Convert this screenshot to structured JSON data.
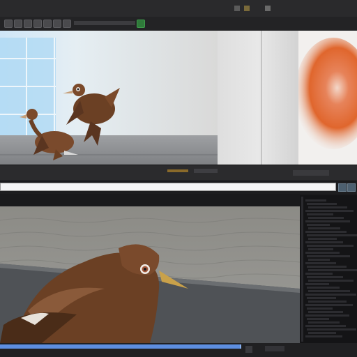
{
  "window": {
    "title": "",
    "menu_left": "",
    "menu_right": ""
  },
  "icons": {
    "toolbar": [
      "arrow-icon",
      "move-icon",
      "rotate-icon",
      "scale-icon",
      "camera-icon",
      "light-icon",
      "grid-icon",
      "snap-icon",
      "play-icon"
    ],
    "window": [
      "minimize-icon",
      "maximize-icon",
      "close-icon"
    ],
    "address": [
      "refresh-icon",
      "settings-icon"
    ]
  },
  "colors": {
    "accent": "#5d8ee0",
    "bird": "#6b4024",
    "particles": "#e0662d"
  },
  "status": {
    "left": "",
    "right": ""
  }
}
